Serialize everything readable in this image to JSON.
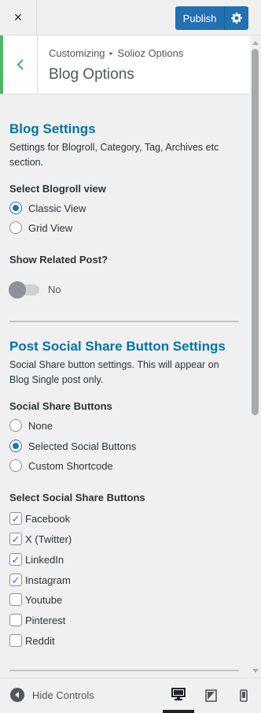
{
  "header": {
    "close_label": "×",
    "publish_label": "Publish"
  },
  "section": {
    "breadcrumb_root": "Customizing",
    "breadcrumb_parent": "Solioz Options",
    "title": "Blog Options"
  },
  "blog_settings": {
    "title": "Blog Settings",
    "description": "Settings for Blogroll, Category, Tag, Archives etc section.",
    "blogroll_label": "Select Blogroll view",
    "blogroll_options": [
      {
        "label": "Classic View",
        "checked": true
      },
      {
        "label": "Grid View",
        "checked": false
      }
    ],
    "related_label": "Show Related Post?",
    "related_value": "No"
  },
  "social": {
    "title": "Post Social Share Button Settings",
    "description": "Social Share button settings. This will appear on Blog Single post only.",
    "buttons_label": "Social Share Buttons",
    "buttons_options": [
      {
        "label": "None",
        "checked": false
      },
      {
        "label": "Selected Social Buttons",
        "checked": true
      },
      {
        "label": "Custom Shortcode",
        "checked": false
      }
    ],
    "select_label": "Select Social Share Buttons",
    "networks": [
      {
        "label": "Facebook",
        "checked": true
      },
      {
        "label": "X (Twitter)",
        "checked": true
      },
      {
        "label": "LinkedIn",
        "checked": true
      },
      {
        "label": "Instagram",
        "checked": true
      },
      {
        "label": "Youtube",
        "checked": false
      },
      {
        "label": "Pinterest",
        "checked": false
      },
      {
        "label": "Reddit",
        "checked": false
      }
    ]
  },
  "footer": {
    "hide_controls_label": "Hide Controls"
  },
  "colors": {
    "accent": "#2271b1",
    "heading": "#0073aa",
    "back_bar": "#4ab866"
  }
}
